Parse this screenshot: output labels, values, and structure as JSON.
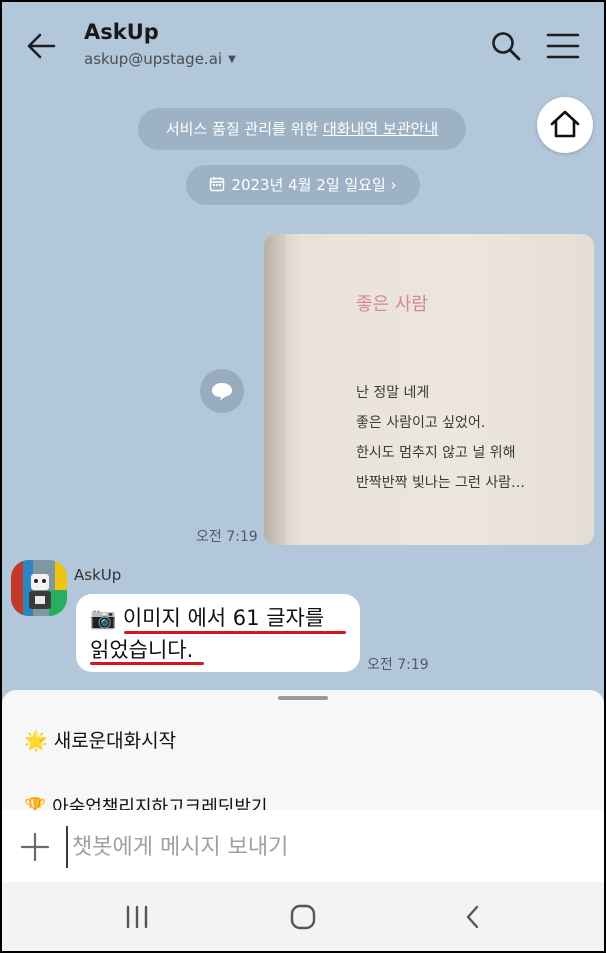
{
  "header": {
    "title": "AskUp",
    "account": "askup@upstage.ai"
  },
  "notice": {
    "prefix": "서비스 품질 관리를 위한 ",
    "link": "대화내역 보관안내"
  },
  "date_divider": {
    "label": "2023년 4월 2일 일요일",
    "chevron": "›"
  },
  "sent_image": {
    "title": "좋은 사람",
    "lines": [
      "난 정말 네게",
      "좋은 사람이고 싶었어.",
      "한시도 멈추지 않고 널 위해",
      "반짝반짝 빛나는 그런 사람…"
    ],
    "time": "오전 7:19"
  },
  "bot_message": {
    "sender": "AskUp",
    "icon": "📷",
    "line1": "이미지 에서 61 글자를",
    "line2": "읽었습니다.",
    "time": "오전 7:19"
  },
  "quick_actions": [
    {
      "icon": "🌟",
      "label": "새로운대화시작"
    },
    {
      "icon": "🏆",
      "label": "아숙업책리지하고크레딧받기"
    }
  ],
  "composer": {
    "placeholder": "챗봇에게 메시지 보내기"
  },
  "icons": [
    "back-arrow-icon",
    "search-icon",
    "menu-icon",
    "home-icon",
    "calendar-icon",
    "share-icon",
    "plus-icon",
    "recent-apps-icon",
    "home-nav-icon",
    "back-nav-icon"
  ],
  "colors": {
    "chat_background": "#b2c7da",
    "bubble": "#ffffff",
    "underline": "#d01a1a"
  }
}
